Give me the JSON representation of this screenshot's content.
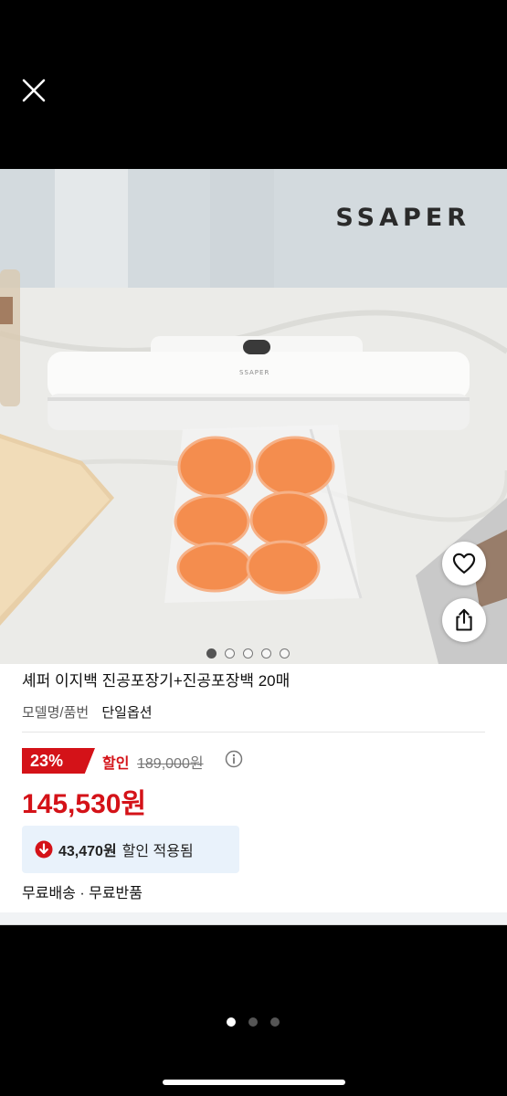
{
  "viewer": {
    "close_icon": "close-icon",
    "pager": {
      "count": 3,
      "active_index": 0
    }
  },
  "product_image": {
    "brand_logo": "SSAPER",
    "device_brand": "SSAPER",
    "actions": {
      "like_icon": "heart-icon",
      "share_icon": "share-icon"
    },
    "carousel": {
      "count": 5,
      "active_index": 0
    }
  },
  "product": {
    "title": "셰퍼 이지백 진공포장기+진공포장백 20매",
    "model_label": "모델명/품번",
    "model_value": "단일옵션",
    "discount_rate": "23%",
    "sale_label": "할인",
    "original_price": "189,000원",
    "final_price": "145,530원",
    "coupon": {
      "amount": "43,470원",
      "text": "할인 적용됨",
      "icon": "arrow-down-circle-icon"
    },
    "shipping": "무료배송 · 무료반품"
  },
  "colors": {
    "accent": "#d41218",
    "coupon_bg": "#e9f2fb"
  }
}
